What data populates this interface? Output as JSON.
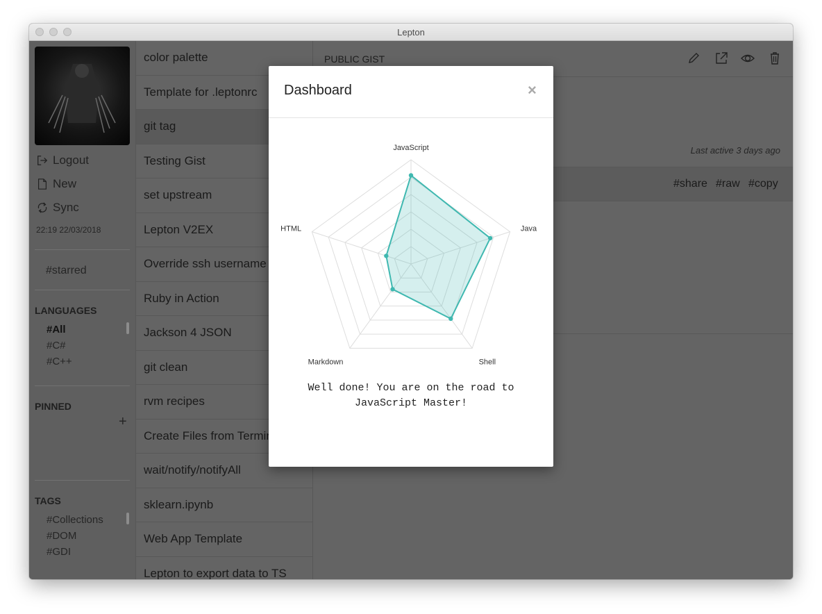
{
  "window": {
    "title": "Lepton"
  },
  "sidebar": {
    "logout_label": "Logout",
    "new_label": "New",
    "sync_label": "Sync",
    "sync_time": "22:19 22/03/2018",
    "starred_label": "#starred",
    "languages_header": "LANGUAGES",
    "languages": [
      "#All",
      "#C#",
      "#C++"
    ],
    "pinned_header": "PINNED",
    "tags_header": "TAGS",
    "tags": [
      "#Collections",
      "#DOM",
      "#GDI"
    ]
  },
  "gist_list": [
    "color palette",
    "Template for .leptonrc",
    "git tag",
    "Testing Gist",
    "set upstream",
    "Lepton V2EX",
    "Override ssh username",
    "Ruby in Action",
    "Jackson 4 JSON",
    "git clean",
    "rvm recipes",
    "Create Files from Terminal",
    "wait/notify/notifyAll",
    "sklearn.ipynb",
    "Web App Template",
    "Lepton to export data to TS"
  ],
  "main": {
    "gist_label": "PUBLIC GIST",
    "last_active": "Last active 3 days ago",
    "actions": [
      "#share",
      "#raw",
      "#copy"
    ],
    "icons": [
      "pencil-icon",
      "external-link-icon",
      "eye-icon",
      "trash-icon"
    ]
  },
  "modal": {
    "title": "Dashboard",
    "close_label": "×",
    "message_line1": "Well done! You are on the road to",
    "message_line2": "JavaScript Master!"
  },
  "chart_data": {
    "type": "radar",
    "axes": [
      "JavaScript",
      "Java",
      "Shell",
      "Markdown",
      "HTML"
    ],
    "values": [
      0.85,
      0.8,
      0.65,
      0.3,
      0.25
    ],
    "range": [
      0,
      1
    ],
    "rings": 6,
    "color": "#3fb8b0",
    "fill": "rgba(63,184,176,0.22)"
  },
  "colors": {
    "accent": "#3fb8b0",
    "window_bg": "#646464"
  }
}
